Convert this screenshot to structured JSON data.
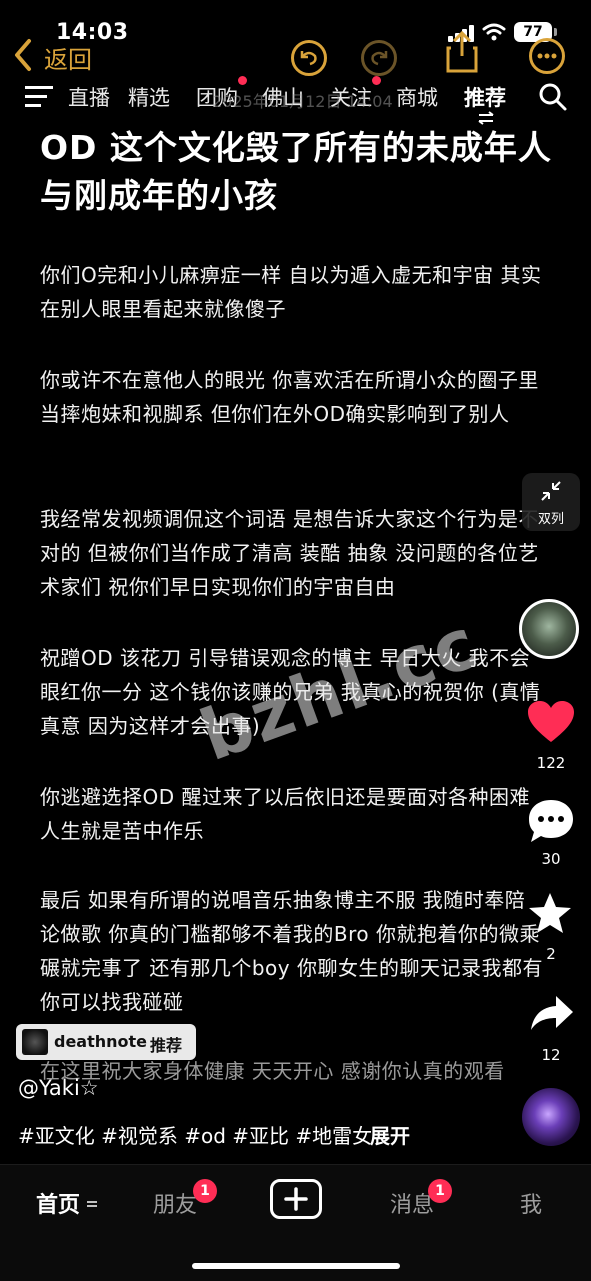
{
  "status": {
    "time": "14:03",
    "battery": "77"
  },
  "header": {
    "back_label": "返回"
  },
  "nav": {
    "tabs": [
      "直播",
      "精选",
      "团购",
      "佛山",
      "关注",
      "商城",
      "推荐"
    ],
    "overlay_date": "2025年01月12日 14:04",
    "active": "推荐"
  },
  "article": {
    "title": "OD 这个文化毁了所有的未成年人与刚成年的小孩",
    "paragraphs": [
      "你们O完和小儿麻痹症一样 自以为遁入虚无和宇宙 其实在别人眼里看起来就像傻子",
      "你或许不在意他人的眼光 你喜欢活在所谓小众的圈子里当摔炮妹和视脚系 但你们在外OD确实影响到了别人",
      "我经常发视频调侃这个词语 是想告诉大家这个行为是不对的 但被你们当作成了清高 装酷 抽象 没问题的各位艺术家们 祝你们早日实现你们的宇宙自由",
      "祝蹭OD 该花刀 引导错误观念的博主 早日大火 我不会眼红你一分 这个钱你该赚的兄弟 我真心的祝贺你 (真情真意 因为这样才会出事)",
      "你逃避选择OD 醒过来了以后依旧还是要面对各种困难 人生就是苦中作乐",
      "最后 如果有所谓的说唱音乐抽象博主不服 我随时奉陪 论做歌 你真的门槛都够不着我的Bro 你就抱着你的微乘碾就完事了 还有那几个boy 你聊女生的聊天记录我都有 你可以找我碰碰",
      "在这里祝大家身体健康 天天开心 感谢你认真的观看"
    ]
  },
  "side": {
    "double_col_label": "双列",
    "likes": "122",
    "comments": "30",
    "favorites": "2",
    "shares": "12"
  },
  "watermark": "bzhl.cc",
  "music_tag": {
    "name": "deathnote",
    "label": "推荐"
  },
  "author": "@Yaki☆",
  "hashtags": "#亚文化 #视觉系 #od #亚比 #地雷女",
  "expand_label": "展开",
  "bottom_nav": {
    "home": "首页",
    "friends": "朋友",
    "friends_badge": "1",
    "messages": "消息",
    "messages_badge": "1",
    "me": "我"
  },
  "colors": {
    "accent_gold": "#d9a33a",
    "like_red": "#ff2d55",
    "background": "#000000"
  }
}
